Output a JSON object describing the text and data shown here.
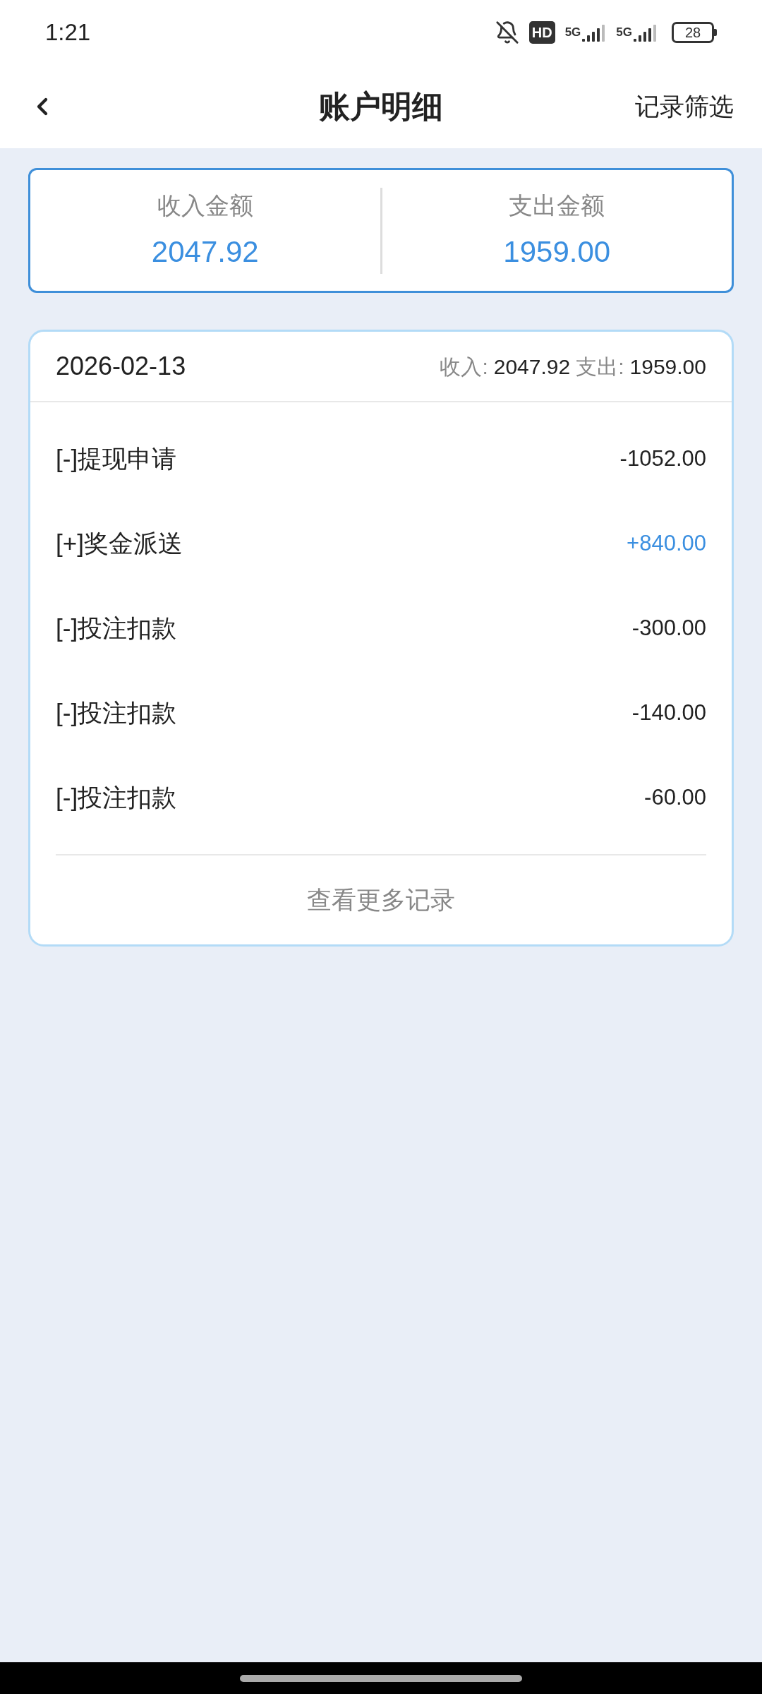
{
  "status_bar": {
    "time": "1:21",
    "hd_label": "HD",
    "signals": [
      {
        "label": "5G"
      },
      {
        "label": "5G"
      }
    ],
    "battery": "28"
  },
  "header": {
    "title": "账户明细",
    "action": "记录筛选"
  },
  "summary": [
    {
      "label": "收入金额",
      "value": "2047.92"
    },
    {
      "label": "支出金额",
      "value": "1959.00"
    }
  ],
  "day": {
    "date": "2026-02-13",
    "income_label": "收入:",
    "income": "2047.92",
    "expense_label": "支出:",
    "expense": "1959.00",
    "records": [
      {
        "title": "[-]提现申请",
        "amount": "-1052.00",
        "kind": "expense"
      },
      {
        "title": "[+]奖金派送",
        "amount": "+840.00",
        "kind": "income"
      },
      {
        "title": "[-]投注扣款",
        "amount": "-300.00",
        "kind": "expense"
      },
      {
        "title": "[-]投注扣款",
        "amount": "-140.00",
        "kind": "expense"
      },
      {
        "title": "[-]投注扣款",
        "amount": "-60.00",
        "kind": "expense"
      }
    ],
    "more": "查看更多记录"
  }
}
